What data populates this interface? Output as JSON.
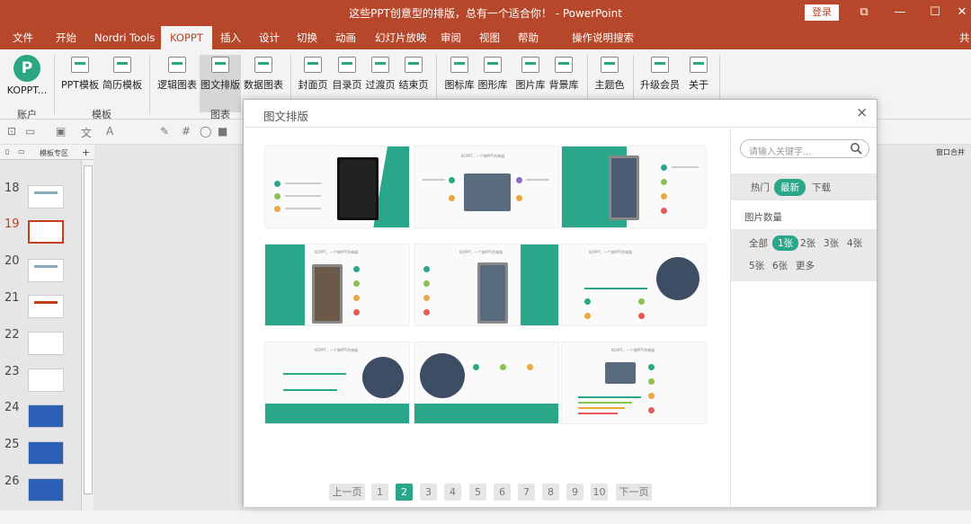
{
  "window": {
    "title": "这些PPT创意型的排版，总有一个适合你！ - PowerPoint",
    "login_label": "登录",
    "controls": [
      "⧉",
      "—",
      "☐",
      "✕"
    ]
  },
  "menu": {
    "tabs": [
      "文件",
      "开始",
      "Nordri Tools",
      "KOPPT",
      "插入",
      "设计",
      "切换",
      "动画",
      "幻灯片放映",
      "审阅",
      "视图",
      "帮助",
      "操作说明搜索"
    ],
    "user_label": "共"
  },
  "ribbon": {
    "account": {
      "button": "KOPPT...",
      "group": "账户"
    },
    "template": {
      "buttons": [
        "PPT模板",
        "简历模板"
      ],
      "group": "模板"
    },
    "chart": {
      "buttons": [
        "逻辑图表",
        "图文排版",
        "数据图表"
      ],
      "group": "图表"
    },
    "pages": {
      "buttons": [
        "封面页",
        "目录页",
        "过渡页",
        "结束页"
      ]
    },
    "libraries": {
      "buttons": [
        "图标库",
        "图形库",
        "图片库",
        "背景库"
      ]
    },
    "theme": {
      "buttons": [
        "主题色"
      ]
    },
    "member": {
      "buttons": [
        "升级会员",
        "关于"
      ]
    }
  },
  "panel": {
    "tab_label": "模板专区",
    "slides": [
      "18",
      "19",
      "20",
      "21",
      "22",
      "23",
      "24",
      "25",
      "26"
    ],
    "active_slide": "19"
  },
  "right_panel": {
    "label": "窗口合并"
  },
  "dialog": {
    "title": "图文排版",
    "close": "×",
    "card_caption": "KOPPT，一个做PPT的神器",
    "search_placeholder": "请输入关键字...",
    "sort": [
      "热门",
      "最新",
      "下载"
    ],
    "sort_active": "最新",
    "count_label": "图片数量",
    "counts": [
      "全部",
      "1张",
      "2张",
      "3张",
      "4张",
      "5张",
      "6张",
      "更多"
    ],
    "count_active": "1张",
    "pager": {
      "prev": "上一页",
      "pages": [
        "1",
        "2",
        "3",
        "4",
        "5",
        "6",
        "7",
        "8",
        "9",
        "10"
      ],
      "current": "2",
      "next": "下一页"
    }
  },
  "colors": {
    "accent": "#2aa68a",
    "brand": "#b7472a"
  }
}
